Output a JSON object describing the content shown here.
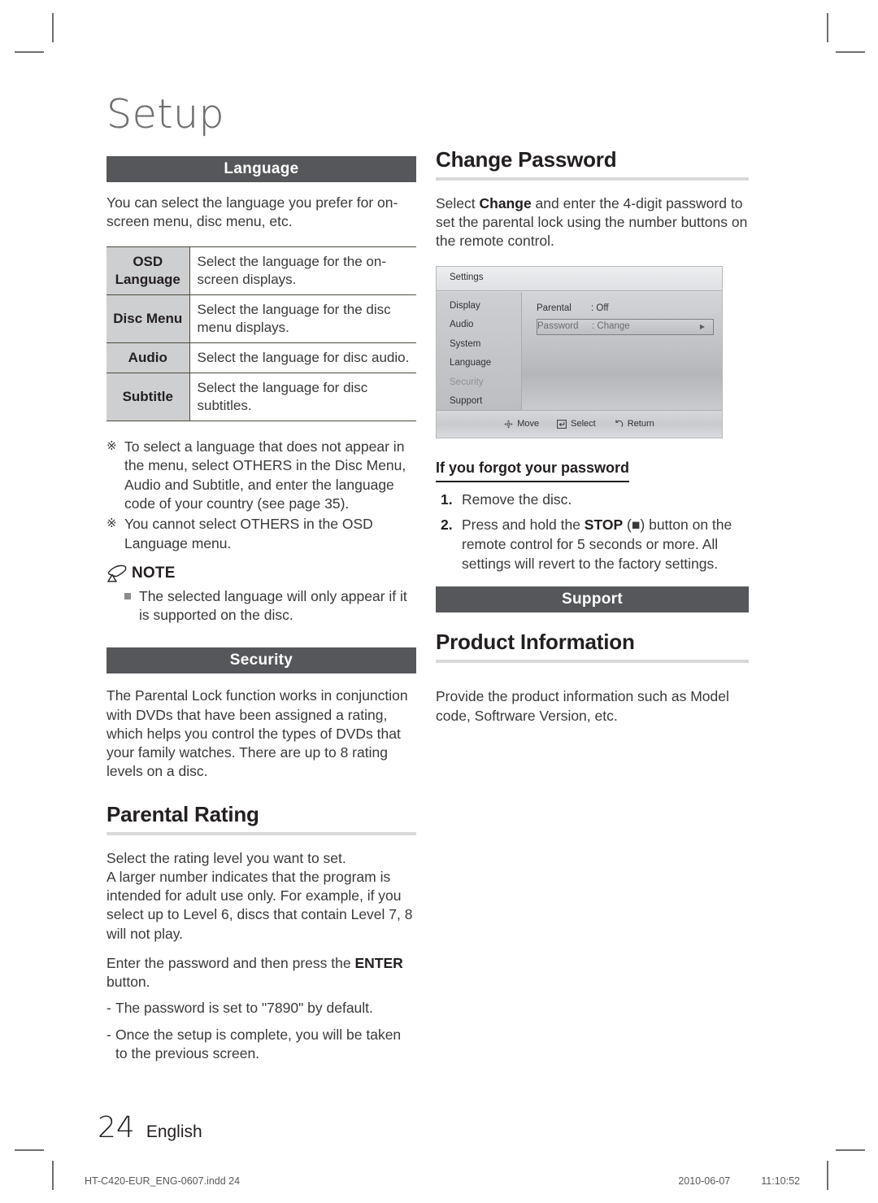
{
  "chapter": {
    "title": "Setup"
  },
  "left_column": {
    "language_band": "Language",
    "language_intro": "You can select the language you prefer for on-screen menu, disc menu, etc.",
    "language_table": {
      "rows": [
        {
          "key": "OSD Language",
          "key_line1": "OSD",
          "key_line2": "Language",
          "value": "Select the language for the on-screen displays."
        },
        {
          "key": "Disc Menu",
          "key_line1": "Disc Menu",
          "key_line2": "",
          "value": "Select the language for the disc menu displays."
        },
        {
          "key": "Audio",
          "key_line1": "Audio",
          "key_line2": "",
          "value": "Select the language for disc audio."
        },
        {
          "key": "Subtitle",
          "key_line1": "Subtitle",
          "key_line2": "",
          "value": "Select the language for disc subtitles."
        }
      ]
    },
    "asterisk_notes": [
      {
        "mark": "※",
        "text": "To select a language that does not appear in the menu, select OTHERS in the Disc Menu, Audio and Subtitle, and enter the language code of your country (see page 35)."
      },
      {
        "mark": "※",
        "text": "You cannot select OTHERS in the OSD Language menu."
      }
    ],
    "note_label": "NOTE",
    "note_items": [
      "The selected language will only appear if it is supported on the disc."
    ],
    "security_band": "Security",
    "security_intro": "The Parental Lock function works in conjunction with DVDs that have been assigned a rating, which helps you control the types of DVDs that your family watches. There are up to 8 rating levels on a disc.",
    "parental_rating_heading": "Parental Rating",
    "parental_rating_p1": "Select the rating level you want to set.",
    "parental_rating_p2": "A larger number indicates that the program is intended for adult use only. For example, if you select up to Level 6, discs that contain Level 7, 8 will not play.",
    "parental_rating_p3_pre": "Enter the password and then press the ",
    "parental_rating_p3_bold": "ENTER",
    "parental_rating_p3_post": " button.",
    "parental_rating_dashes": [
      "The password is set to \"7890\" by default.",
      "Once the setup is complete, you will be taken to the previous screen."
    ]
  },
  "right_column": {
    "change_password_heading": "Change Password",
    "change_password_pre": "Select ",
    "change_password_bold": "Change",
    "change_password_post": " and enter the 4-digit password to set the parental lock using the number buttons on the remote control.",
    "tv_screenshot": {
      "window_title": "Settings",
      "nav_items": [
        {
          "label": "Display",
          "dim": false
        },
        {
          "label": "Audio",
          "dim": false
        },
        {
          "label": "System",
          "dim": false
        },
        {
          "label": "Language",
          "dim": false
        },
        {
          "label": "Security",
          "dim": true
        },
        {
          "label": "Support",
          "dim": false
        }
      ],
      "rows": [
        {
          "key": "Parental",
          "value": ": Off",
          "selected": false
        },
        {
          "key": "Password",
          "value": ": Change",
          "selected": true
        }
      ],
      "footer_actions": [
        {
          "icon": "dpad-move-icon",
          "label": "Move"
        },
        {
          "icon": "enter-select-icon",
          "label": "Select"
        },
        {
          "icon": "return-arrow-icon",
          "label": "Return"
        }
      ]
    },
    "forgot_heading": "If you forgot your password",
    "forgot_steps": [
      {
        "num": "1.",
        "pre": "Remove the disc.",
        "bold": "",
        "post": ""
      },
      {
        "num": "2.",
        "pre": "Press and hold the ",
        "bold": "STOP",
        "post": " (■) button on the remote control for 5 seconds or more. All settings will revert to the factory settings."
      }
    ],
    "support_band": "Support",
    "product_info_heading": "Product Information",
    "product_info_text": "Provide the product information such as Model code, Softrware Version, etc."
  },
  "footer": {
    "page_number": "24",
    "language": "English",
    "file_name": "HT-C420-EUR_ENG-0607.indd   24",
    "date": "2010-06-07",
    "time": "11:10:52"
  },
  "colors": {
    "band_bg": "#56575a",
    "band_text": "#ffffff",
    "rule": "#d9d9d9",
    "table_key_bg": "#cdcfd1",
    "table_border": "#4d4a3c",
    "body_text": "#3a3a3c",
    "chapter_title": "#6d6e71"
  }
}
